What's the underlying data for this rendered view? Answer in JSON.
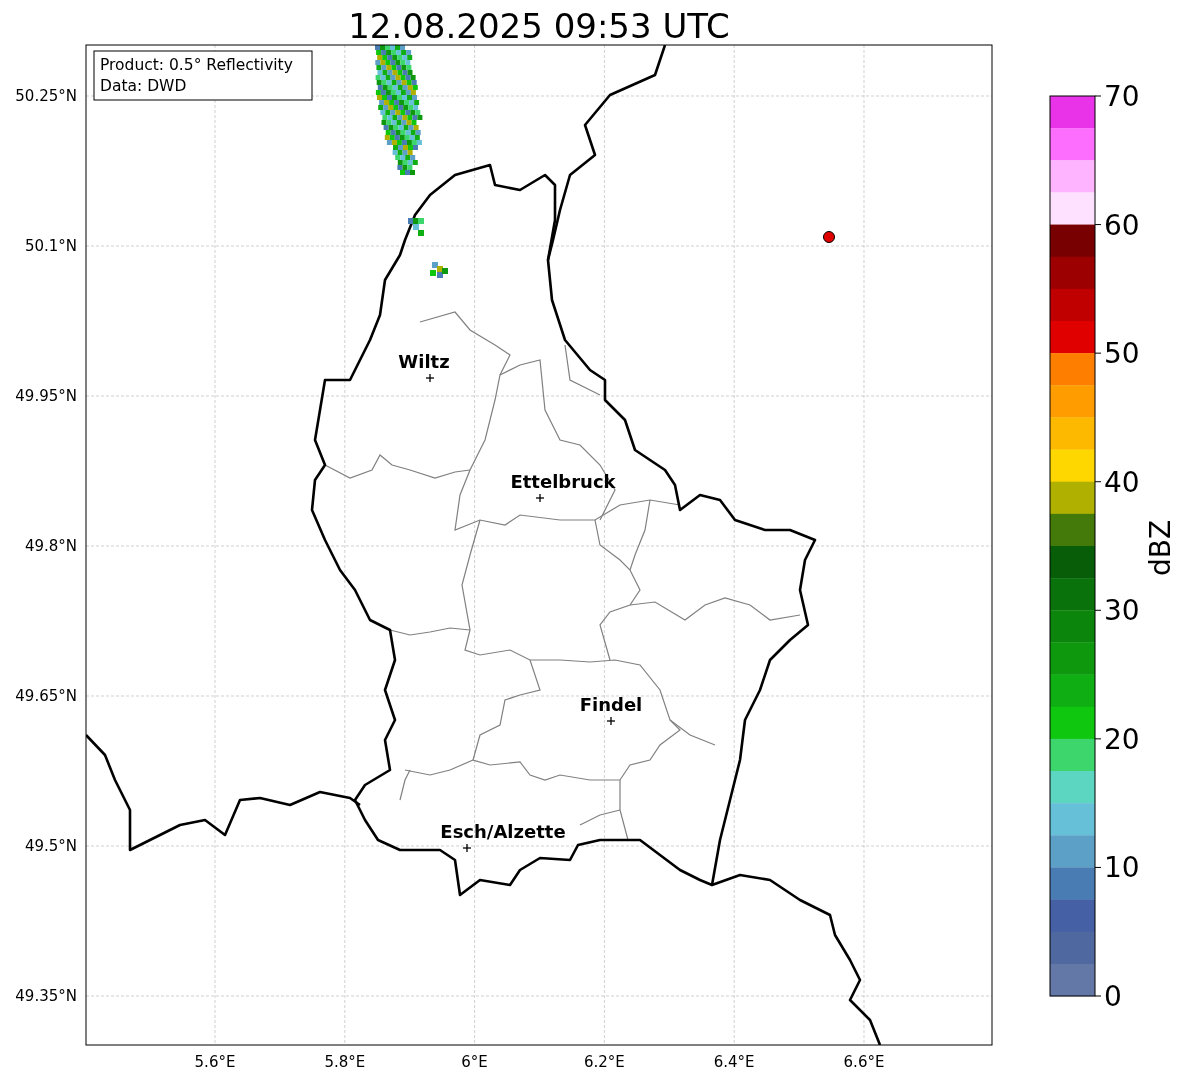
{
  "title": "12.08.2025 09:53 UTC",
  "info_box": [
    "Product: 0.5° Reflectivity",
    "Data: DWD"
  ],
  "map": {
    "lat_labels": [
      "50.25°N",
      "50.1°N",
      "49.95°N",
      "49.8°N",
      "49.65°N",
      "49.5°N",
      "49.35°N"
    ],
    "lon_labels": [
      "5.6°E",
      "5.8°E",
      "6°E",
      "6.2°E",
      "6.4°E",
      "6.6°E"
    ],
    "cities": [
      "Wiltz",
      "Ettelbruck",
      "Findel",
      "Esch/Alzette"
    ]
  },
  "colorbar": {
    "ticks": [
      "70",
      "60",
      "50",
      "40",
      "30",
      "20",
      "10",
      "0"
    ],
    "colors": [
      {
        "color": "#e833e8"
      },
      {
        "color": "#fe6efe"
      },
      {
        "color": "#feb4fe"
      },
      {
        "color": "#fee1fe"
      },
      {
        "color": "#780000"
      },
      {
        "color": "#9c0000"
      },
      {
        "color": "#c00000"
      },
      {
        "color": "#e00000"
      },
      {
        "color": "#fe7e00"
      },
      {
        "color": "#fe9c00"
      },
      {
        "color": "#fdb800"
      },
      {
        "color": "#fed700"
      },
      {
        "color": "#b0b000"
      },
      {
        "color": "#437a0a"
      },
      {
        "color": "#085d08"
      },
      {
        "color": "#0a720a"
      },
      {
        "color": "#0b850b"
      },
      {
        "color": "#0d980d"
      },
      {
        "color": "#0fae13"
      },
      {
        "color": "#10c710"
      },
      {
        "color": "#3cd66c"
      },
      {
        "color": "#5cd6c0"
      },
      {
        "color": "#66c0d8"
      },
      {
        "color": "#5ca0c8"
      },
      {
        "color": "#4a7cb4"
      },
      {
        "color": "#4560a4"
      },
      {
        "color": "#5068a0"
      },
      {
        "color": "#6478a8"
      }
    ],
    "label": "dBZ"
  }
}
